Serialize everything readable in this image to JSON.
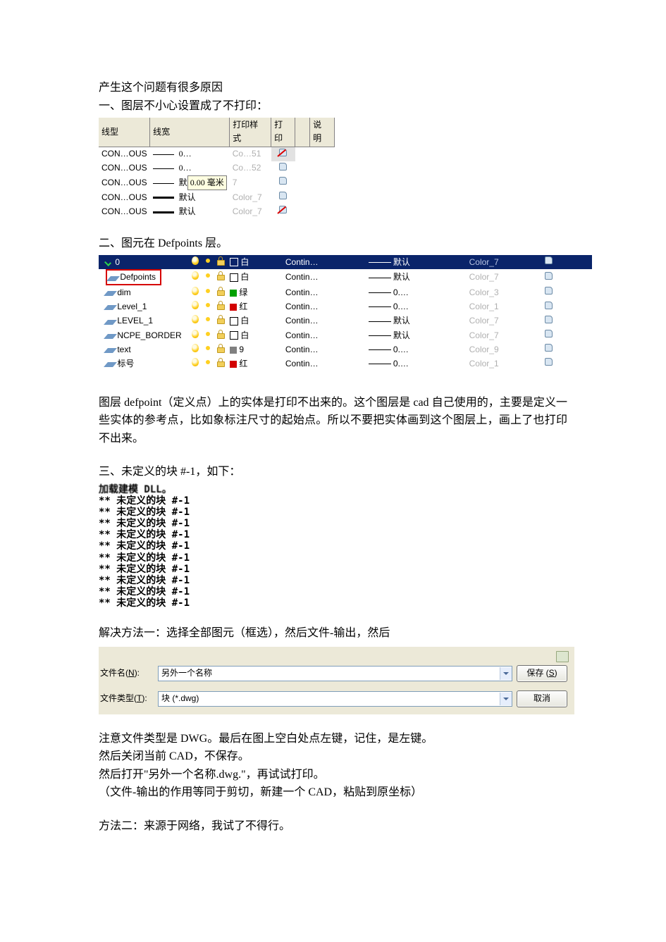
{
  "intro": {
    "line1": "产生这个问题有很多原因",
    "sec1_title": "一、图层不小心设置成了不打印：",
    "sec2_title": "二、图元在 Defpoints 层。",
    "sec3_title": "三、未定义的块 #-1，如下：",
    "solution1": "解决方法一：选择全部图元（框选），然后文件-输出，然后",
    "note1": "注意文件类型是 DWG。最后在图上空白处点左键，记住，是左键。",
    "note2": "然后关闭当前 CAD，不保存。",
    "note3": "然后打开\"另外一个名称.dwg.\"，再试试打印。",
    "note4": "（文件-输出的作用等同于剪切，新建一个 CAD，粘贴到原坐标）",
    "method2": "方法二：来源于网络，我试了不得行。",
    "defpoint_para": "图层 defpoint（定义点）上的实体是打印不出来的。这个图层是 cad 自己使用的，主要是定义一些实体的参考点，比如象标注尺寸的起始点。所以不要把实体画到这个图层上，画上了也打印不出来。"
  },
  "tbl1": {
    "headers": {
      "lt": "线型",
      "lw": "线宽",
      "ps": "打印样式",
      "pr": "打印",
      "desc": "说明"
    },
    "rows": [
      {
        "lt": "CON…OUS",
        "lw": "0…",
        "ps": "Co…51",
        "print": false,
        "sel": true
      },
      {
        "lt": "CON…OUS",
        "lw": "0…",
        "ps": "Co…52",
        "print": true
      },
      {
        "lt": "CON…OUS",
        "lw": "默",
        "ps": "7",
        "print": true,
        "tooltip": "0.00 毫米"
      },
      {
        "lt": "CON…OUS",
        "lw": "默认",
        "ps": "Color_7",
        "print": true,
        "thick": true
      },
      {
        "lt": "CON…OUS",
        "lw": "默认",
        "ps": "Color_7",
        "print": false,
        "thick": true,
        "half": true
      }
    ]
  },
  "layers": {
    "rows": [
      {
        "name": "0",
        "colorName": "白",
        "lw": "默认",
        "ps": "Color_7",
        "sel": true,
        "swatch": "white-sel",
        "first": true
      },
      {
        "name": "Defpoints",
        "colorName": "白",
        "lw": "默认",
        "ps": "Color_7",
        "swatch": "outline",
        "hl": true
      },
      {
        "name": "dim",
        "colorName": "绿",
        "lw": "0.…",
        "ps": "Color_3",
        "swatch": "green"
      },
      {
        "name": "Level_1",
        "colorName": "红",
        "lw": "0.…",
        "ps": "Color_1",
        "swatch": "red"
      },
      {
        "name": "LEVEL_1",
        "colorName": "白",
        "lw": "默认",
        "ps": "Color_7",
        "swatch": "outline"
      },
      {
        "name": "NCPE_BORDER",
        "colorName": "白",
        "lw": "默认",
        "ps": "Color_7",
        "swatch": "outline"
      },
      {
        "name": "text",
        "colorName": "9",
        "lw": "0.…",
        "ps": "Color_9",
        "swatch": "grey"
      },
      {
        "name": "标号",
        "colorName": "红",
        "lw": "0.…",
        "ps": "Color_1",
        "swatch": "red"
      }
    ],
    "linetype": "Contin…"
  },
  "cmd": {
    "header": "加载建模 DLL。",
    "line": "** 未定义的块 #-1",
    "count": 10
  },
  "save": {
    "label_name": "文件名",
    "label_name_accel": "N",
    "label_type": "文件类型",
    "label_type_accel": "T",
    "filename": "另外一个名称",
    "filetype": "块 (*.dwg)",
    "btn_save": "保存 (S)",
    "btn_save_accel_char": "S",
    "btn_cancel": "取消"
  }
}
